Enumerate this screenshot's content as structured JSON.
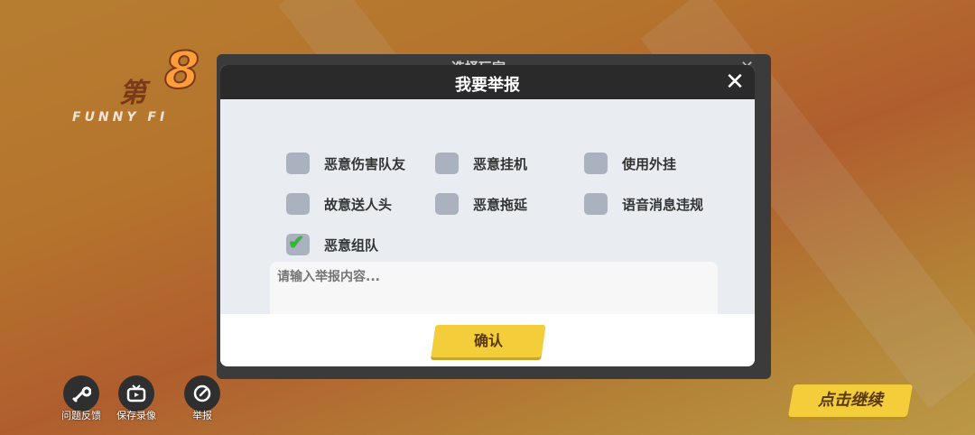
{
  "background": {
    "round_prefix": "第",
    "round_number": "8",
    "subtitle": "FUNNY FI",
    "back_panel_title": "选择玩家"
  },
  "dialog": {
    "title": "我要举报",
    "options": [
      {
        "label": "恶意伤害队友",
        "checked": false
      },
      {
        "label": "恶意挂机",
        "checked": false
      },
      {
        "label": "使用外挂",
        "checked": false
      },
      {
        "label": "故意送人头",
        "checked": false
      },
      {
        "label": "恶意拖延",
        "checked": false
      },
      {
        "label": "语音消息违规",
        "checked": false
      },
      {
        "label": "恶意组队",
        "checked": true
      }
    ],
    "input_placeholder": "请输入举报内容...",
    "confirm_label": "确认"
  },
  "bottom_bar": {
    "feedback_label": "问题反馈",
    "save_replay_label": "保存录像",
    "report_label": "举报"
  },
  "continue_label": "点击继续",
  "colors": {
    "accent_yellow": "#f3cd3a",
    "checkbox_gray": "#aab2bf",
    "check_green": "#2bbf2b"
  }
}
